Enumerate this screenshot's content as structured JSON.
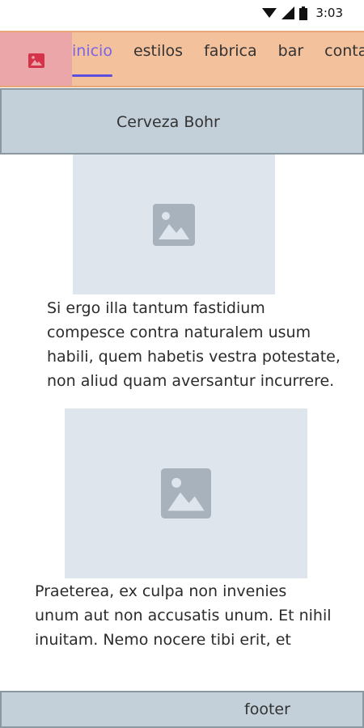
{
  "status_bar": {
    "time": "3:03",
    "icons": [
      "wifi-icon",
      "signal-icon",
      "battery-icon"
    ]
  },
  "nav": {
    "logo_icon": "image-icon",
    "items": [
      {
        "label": "inicio",
        "active": true
      },
      {
        "label": "estilos"
      },
      {
        "label": "fabrica"
      },
      {
        "label": "bar"
      },
      {
        "label": "contacto"
      }
    ],
    "accent_color": "#5e4ee0"
  },
  "header": {
    "title": "Cerveza Bohr"
  },
  "sections": [
    {
      "image_icon": "image-icon",
      "text": "Si ergo illa tantum fastidium compesce contra naturalem usum habili, quem habetis vestra potestate, non aliud quam aversantur incurrere."
    },
    {
      "image_icon": "image-icon",
      "text": "Praeterea, ex culpa non invenies unum aut non accusatis unum. Et nihil inuitam. Nemo nocere tibi erit, et"
    }
  ],
  "footer": {
    "label": "footer"
  }
}
